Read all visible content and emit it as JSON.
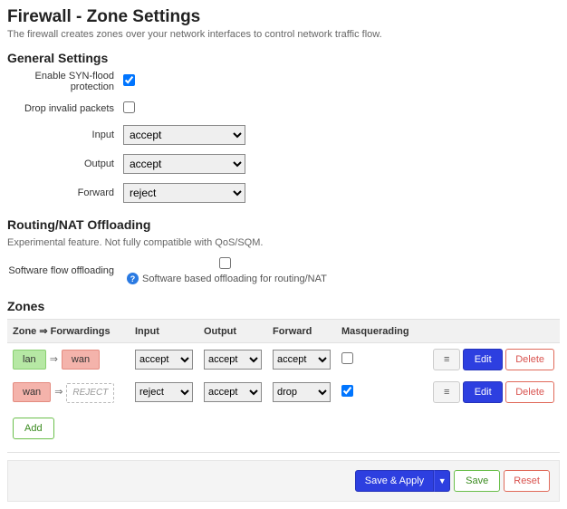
{
  "page": {
    "title": "Firewall - Zone Settings",
    "subtitle": "The firewall creates zones over your network interfaces to control network traffic flow."
  },
  "general": {
    "heading": "General Settings",
    "syn_flood_label": "Enable SYN-flood protection",
    "syn_flood_checked": true,
    "drop_invalid_label": "Drop invalid packets",
    "drop_invalid_checked": false,
    "input_label": "Input",
    "input_value": "accept",
    "output_label": "Output",
    "output_value": "accept",
    "forward_label": "Forward",
    "forward_value": "reject",
    "policy_options": [
      "accept",
      "reject",
      "drop"
    ]
  },
  "offloading": {
    "heading": "Routing/NAT Offloading",
    "description": "Experimental feature. Not fully compatible with QoS/SQM.",
    "software_label": "Software flow offloading",
    "software_checked": false,
    "software_hint": "Software based offloading for routing/NAT"
  },
  "zones": {
    "heading": "Zones",
    "columns": {
      "zone": "Zone ⇒ Forwardings",
      "input": "Input",
      "output": "Output",
      "forward": "Forward",
      "masq": "Masquerading"
    },
    "rows": [
      {
        "from": "lan",
        "from_class": "zone-lan",
        "to": "wan",
        "to_class": "zone-wan",
        "input": "accept",
        "output": "accept",
        "forward": "accept",
        "masq": false
      },
      {
        "from": "wan",
        "from_class": "zone-wan",
        "to": "REJECT",
        "to_class": "zone-reject",
        "input": "reject",
        "output": "accept",
        "forward": "drop",
        "masq": true
      }
    ],
    "buttons": {
      "edit": "Edit",
      "delete": "Delete",
      "add": "Add"
    }
  },
  "footer": {
    "save_apply": "Save & Apply",
    "save": "Save",
    "reset": "Reset"
  }
}
